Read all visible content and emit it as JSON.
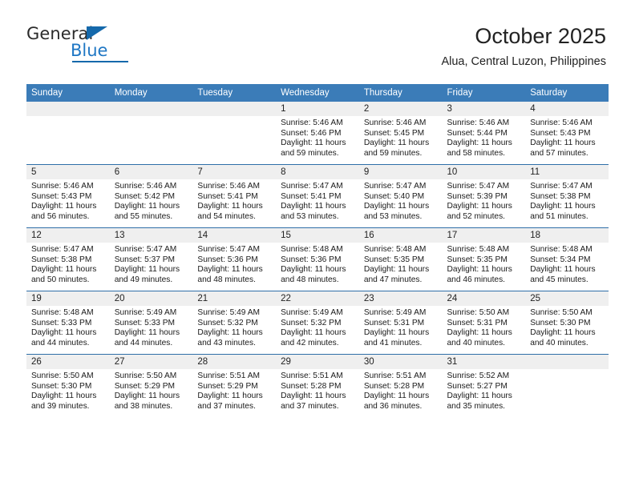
{
  "brand": {
    "name_top": "General",
    "name_bottom": "Blue",
    "accent_color": "#1569ab"
  },
  "header": {
    "title": "October 2025",
    "subtitle": "Alua, Central Luzon, Philippines"
  },
  "theme": {
    "header_row_color": "#3b7cb8",
    "row_divider_color": "#2f6fa8",
    "daynum_background": "#efefef",
    "text_color": "#1a1a1a"
  },
  "calendar": {
    "weekday_headers": [
      "Sunday",
      "Monday",
      "Tuesday",
      "Wednesday",
      "Thursday",
      "Friday",
      "Saturday"
    ],
    "weeks": [
      [
        {
          "day": "",
          "lines": []
        },
        {
          "day": "",
          "lines": []
        },
        {
          "day": "",
          "lines": []
        },
        {
          "day": "1",
          "lines": [
            "Sunrise: 5:46 AM",
            "Sunset: 5:46 PM",
            "Daylight: 11 hours",
            "and 59 minutes."
          ]
        },
        {
          "day": "2",
          "lines": [
            "Sunrise: 5:46 AM",
            "Sunset: 5:45 PM",
            "Daylight: 11 hours",
            "and 59 minutes."
          ]
        },
        {
          "day": "3",
          "lines": [
            "Sunrise: 5:46 AM",
            "Sunset: 5:44 PM",
            "Daylight: 11 hours",
            "and 58 minutes."
          ]
        },
        {
          "day": "4",
          "lines": [
            "Sunrise: 5:46 AM",
            "Sunset: 5:43 PM",
            "Daylight: 11 hours",
            "and 57 minutes."
          ]
        }
      ],
      [
        {
          "day": "5",
          "lines": [
            "Sunrise: 5:46 AM",
            "Sunset: 5:43 PM",
            "Daylight: 11 hours",
            "and 56 minutes."
          ]
        },
        {
          "day": "6",
          "lines": [
            "Sunrise: 5:46 AM",
            "Sunset: 5:42 PM",
            "Daylight: 11 hours",
            "and 55 minutes."
          ]
        },
        {
          "day": "7",
          "lines": [
            "Sunrise: 5:46 AM",
            "Sunset: 5:41 PM",
            "Daylight: 11 hours",
            "and 54 minutes."
          ]
        },
        {
          "day": "8",
          "lines": [
            "Sunrise: 5:47 AM",
            "Sunset: 5:41 PM",
            "Daylight: 11 hours",
            "and 53 minutes."
          ]
        },
        {
          "day": "9",
          "lines": [
            "Sunrise: 5:47 AM",
            "Sunset: 5:40 PM",
            "Daylight: 11 hours",
            "and 53 minutes."
          ]
        },
        {
          "day": "10",
          "lines": [
            "Sunrise: 5:47 AM",
            "Sunset: 5:39 PM",
            "Daylight: 11 hours",
            "and 52 minutes."
          ]
        },
        {
          "day": "11",
          "lines": [
            "Sunrise: 5:47 AM",
            "Sunset: 5:38 PM",
            "Daylight: 11 hours",
            "and 51 minutes."
          ]
        }
      ],
      [
        {
          "day": "12",
          "lines": [
            "Sunrise: 5:47 AM",
            "Sunset: 5:38 PM",
            "Daylight: 11 hours",
            "and 50 minutes."
          ]
        },
        {
          "day": "13",
          "lines": [
            "Sunrise: 5:47 AM",
            "Sunset: 5:37 PM",
            "Daylight: 11 hours",
            "and 49 minutes."
          ]
        },
        {
          "day": "14",
          "lines": [
            "Sunrise: 5:47 AM",
            "Sunset: 5:36 PM",
            "Daylight: 11 hours",
            "and 48 minutes."
          ]
        },
        {
          "day": "15",
          "lines": [
            "Sunrise: 5:48 AM",
            "Sunset: 5:36 PM",
            "Daylight: 11 hours",
            "and 48 minutes."
          ]
        },
        {
          "day": "16",
          "lines": [
            "Sunrise: 5:48 AM",
            "Sunset: 5:35 PM",
            "Daylight: 11 hours",
            "and 47 minutes."
          ]
        },
        {
          "day": "17",
          "lines": [
            "Sunrise: 5:48 AM",
            "Sunset: 5:35 PM",
            "Daylight: 11 hours",
            "and 46 minutes."
          ]
        },
        {
          "day": "18",
          "lines": [
            "Sunrise: 5:48 AM",
            "Sunset: 5:34 PM",
            "Daylight: 11 hours",
            "and 45 minutes."
          ]
        }
      ],
      [
        {
          "day": "19",
          "lines": [
            "Sunrise: 5:48 AM",
            "Sunset: 5:33 PM",
            "Daylight: 11 hours",
            "and 44 minutes."
          ]
        },
        {
          "day": "20",
          "lines": [
            "Sunrise: 5:49 AM",
            "Sunset: 5:33 PM",
            "Daylight: 11 hours",
            "and 44 minutes."
          ]
        },
        {
          "day": "21",
          "lines": [
            "Sunrise: 5:49 AM",
            "Sunset: 5:32 PM",
            "Daylight: 11 hours",
            "and 43 minutes."
          ]
        },
        {
          "day": "22",
          "lines": [
            "Sunrise: 5:49 AM",
            "Sunset: 5:32 PM",
            "Daylight: 11 hours",
            "and 42 minutes."
          ]
        },
        {
          "day": "23",
          "lines": [
            "Sunrise: 5:49 AM",
            "Sunset: 5:31 PM",
            "Daylight: 11 hours",
            "and 41 minutes."
          ]
        },
        {
          "day": "24",
          "lines": [
            "Sunrise: 5:50 AM",
            "Sunset: 5:31 PM",
            "Daylight: 11 hours",
            "and 40 minutes."
          ]
        },
        {
          "day": "25",
          "lines": [
            "Sunrise: 5:50 AM",
            "Sunset: 5:30 PM",
            "Daylight: 11 hours",
            "and 40 minutes."
          ]
        }
      ],
      [
        {
          "day": "26",
          "lines": [
            "Sunrise: 5:50 AM",
            "Sunset: 5:30 PM",
            "Daylight: 11 hours",
            "and 39 minutes."
          ]
        },
        {
          "day": "27",
          "lines": [
            "Sunrise: 5:50 AM",
            "Sunset: 5:29 PM",
            "Daylight: 11 hours",
            "and 38 minutes."
          ]
        },
        {
          "day": "28",
          "lines": [
            "Sunrise: 5:51 AM",
            "Sunset: 5:29 PM",
            "Daylight: 11 hours",
            "and 37 minutes."
          ]
        },
        {
          "day": "29",
          "lines": [
            "Sunrise: 5:51 AM",
            "Sunset: 5:28 PM",
            "Daylight: 11 hours",
            "and 37 minutes."
          ]
        },
        {
          "day": "30",
          "lines": [
            "Sunrise: 5:51 AM",
            "Sunset: 5:28 PM",
            "Daylight: 11 hours",
            "and 36 minutes."
          ]
        },
        {
          "day": "31",
          "lines": [
            "Sunrise: 5:52 AM",
            "Sunset: 5:27 PM",
            "Daylight: 11 hours",
            "and 35 minutes."
          ]
        },
        {
          "day": "",
          "lines": []
        }
      ]
    ]
  }
}
